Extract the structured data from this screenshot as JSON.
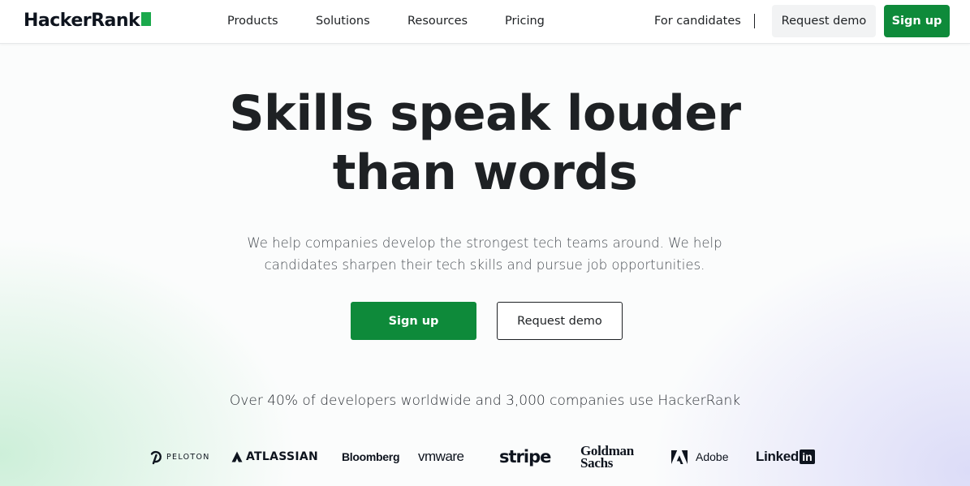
{
  "header": {
    "logo_text": "HackerRank",
    "nav": {
      "products": "Products",
      "solutions": "Solutions",
      "resources": "Resources",
      "pricing": "Pricing",
      "for_candidates": "For candidates"
    },
    "request_demo_label": "Request demo",
    "sign_up_label": "Sign up"
  },
  "hero": {
    "title_line1": "Skills speak louder",
    "title_line2": "than words",
    "subtitle_line1": "We help companies develop the strongest tech teams around. We help",
    "subtitle_line2": "candidates sharpen their tech skills and pursue job opportunities.",
    "sign_up_label": "Sign up",
    "request_demo_label": "Request demo"
  },
  "social_proof": {
    "stat_text": "Over 40% of developers worldwide and 3,000 companies use HackerRank",
    "brands": {
      "peloton": "PELOTON",
      "atlassian": "ATLASSIAN",
      "bloomberg": "Bloomberg",
      "vmware": "vmware",
      "stripe": "stripe",
      "goldman_line1": "Goldman",
      "goldman_line2": "Sachs",
      "adobe": "Adobe",
      "linkedin": "Linked",
      "linkedin_in": "in"
    }
  },
  "colors": {
    "brand_green": "#1ba94c",
    "button_green": "#0e8a3a",
    "text_dark": "#1e2124"
  }
}
